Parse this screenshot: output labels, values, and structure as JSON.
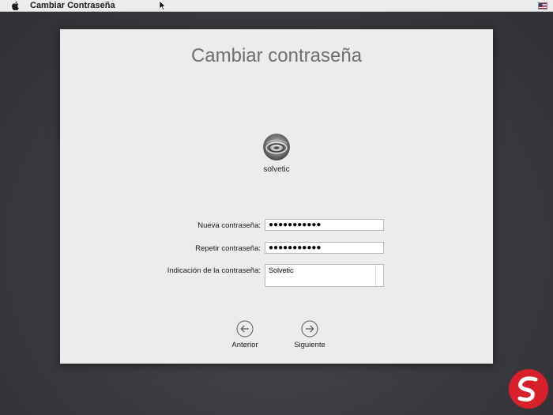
{
  "menubar": {
    "app_title": "Cambiar Contraseña",
    "apple_icon": "apple-icon",
    "flag_icon": "us-flag-icon"
  },
  "dialog": {
    "title": "Cambiar contraseña",
    "user": {
      "name": "solvetic",
      "avatar_icon": "swirl-avatar"
    },
    "fields": {
      "new_password": {
        "label": "Nueva contraseña:",
        "value": "●●●●●●●●●●●"
      },
      "repeat_password": {
        "label": "Repetir contraseña:",
        "value": "●●●●●●●●●●●"
      },
      "hint": {
        "label": "Indicación de la contraseña:",
        "value": "Solvetic"
      }
    },
    "buttons": {
      "back": {
        "label": "Anterior",
        "icon": "arrow-left-circle-icon"
      },
      "next": {
        "label": "Siguiente",
        "icon": "arrow-right-circle-icon"
      }
    }
  },
  "colors": {
    "desktop": "#3a3b3f",
    "panel": "#ececec",
    "title_text": "#6f6f6f",
    "logo_red": "#d8202a"
  }
}
